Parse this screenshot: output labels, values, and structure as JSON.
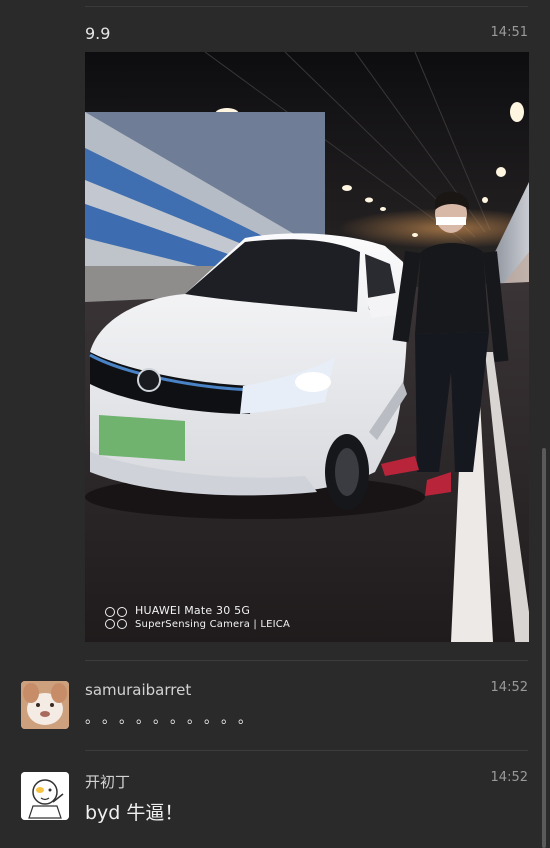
{
  "messages": [
    {
      "text": "9.9",
      "time": "14:51",
      "photo": {
        "watermark_line1": "HUAWEI Mate 30 5G",
        "watermark_line2": "SuperSensing Camera | LEICA"
      }
    },
    {
      "author": "samuraibarret",
      "time": "14:52",
      "text": "。。。。。。。。。。",
      "avatar_icon": "dog-avatar-icon"
    },
    {
      "author": "开初丁",
      "time": "14:52",
      "text": "byd 牛逼！",
      "avatar_icon": "cartoon-avatar-icon"
    }
  ],
  "colors": {
    "background": "#2a2a2a",
    "divider": "#3c3c3c",
    "time_text": "#9a9a9a",
    "tunnel_blue": "#3f6fb0",
    "car_white": "#f2f3f5"
  }
}
